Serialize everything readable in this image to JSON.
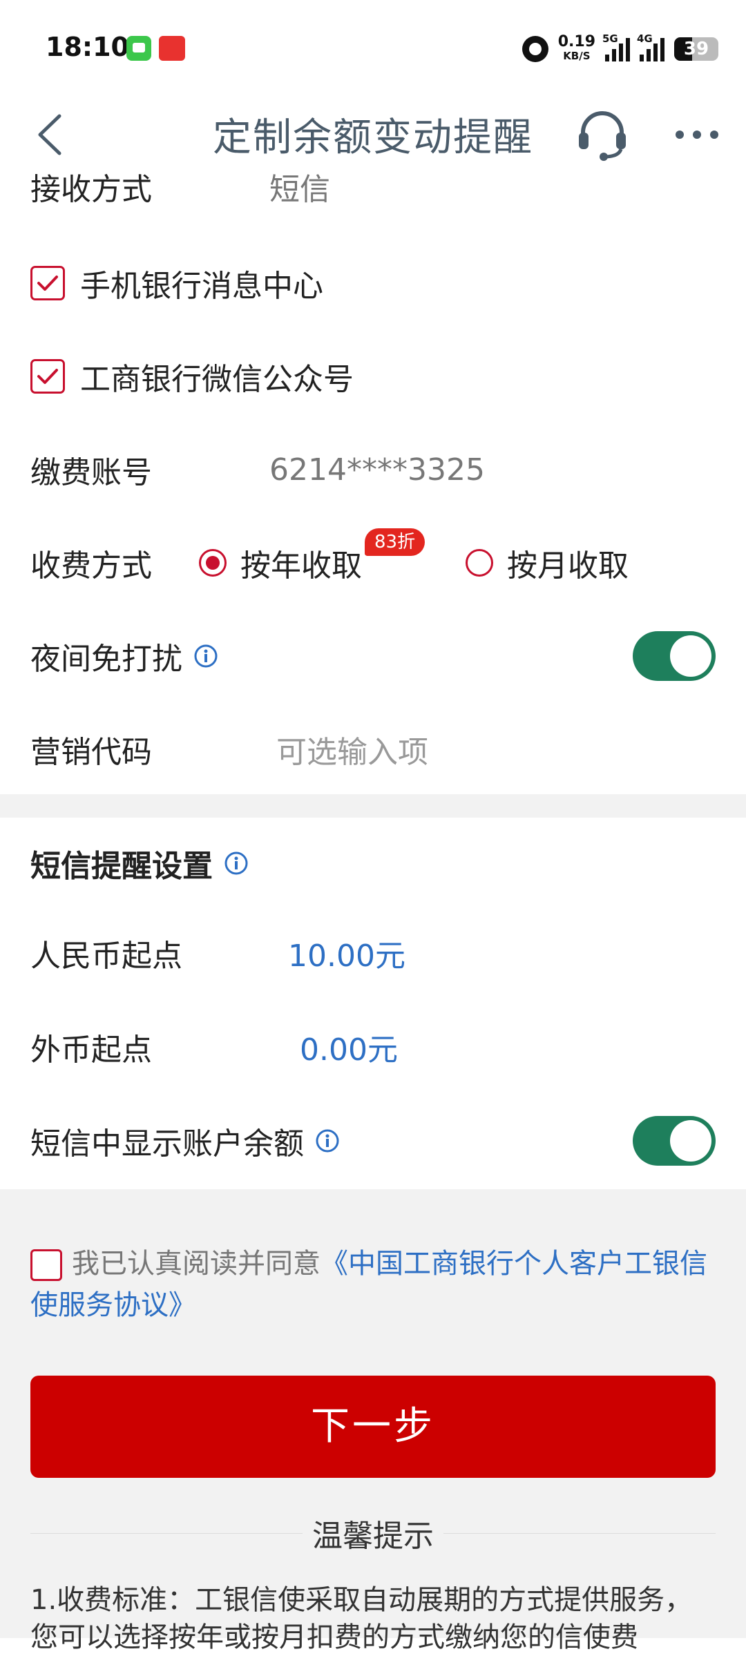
{
  "status_bar": {
    "time": "18:10",
    "speed_value": "0.19",
    "speed_unit": "KB/S",
    "net1": "5G",
    "net2": "4G",
    "battery": "39"
  },
  "nav": {
    "title": "定制余额变动提醒",
    "back_icon": "back-arrow-icon",
    "service_icon": "headset-icon",
    "more_icon": "more-icon"
  },
  "form": {
    "receive_method_label": "接收方式",
    "receive_method_value": "短信",
    "channel_1": "手机银行消息中心",
    "channel_2": "工商银行微信公众号",
    "account_label": "缴费账号",
    "account_value": "6214****3325",
    "fee_method_label": "收费方式",
    "fee_yearly": "按年收取",
    "fee_yearly_badge": "83折",
    "fee_monthly": "按月收取",
    "night_dnd_label": "夜间免打扰",
    "marketing_code_label": "营销代码",
    "marketing_code_placeholder": "可选输入项"
  },
  "sms_settings": {
    "title": "短信提醒设置",
    "rmb_label": "人民币起点",
    "rmb_value": "10.00元",
    "fx_label": "外币起点",
    "fx_value": "0.00元",
    "show_balance_label": "短信中显示账户余额"
  },
  "agreement": {
    "prefix": "我已认真阅读并同意",
    "link": "《中国工商银行个人客户工银信使服务协议》"
  },
  "next_button": "下一步",
  "tips": {
    "title": "温馨提示",
    "text": "1.收费标准：工银信使采取自动展期的方式提供服务，您可以选择按年或按月扣费的方式缴纳您的信使费"
  },
  "colors": {
    "accent_red": "#cc0000",
    "link_blue": "#2d6fc4",
    "toggle_green": "#1e7f5c"
  }
}
